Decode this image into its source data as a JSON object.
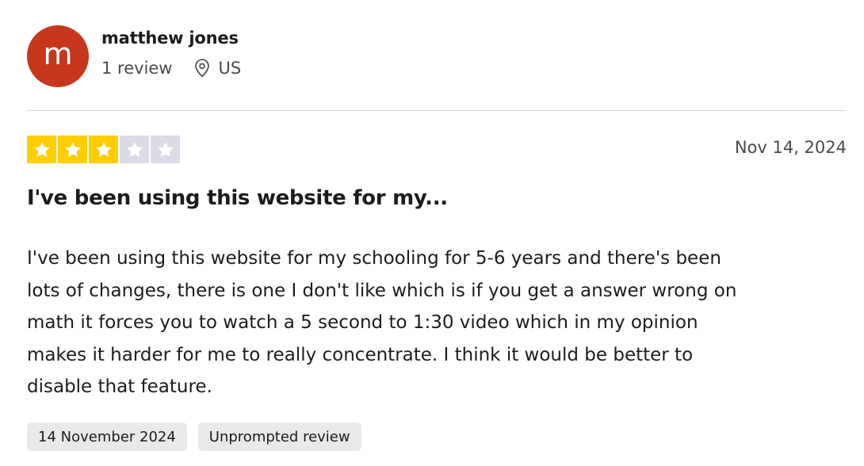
{
  "reviewer": {
    "avatar_letter": "m",
    "avatar_color": "#c7371e",
    "name": "matthew jones",
    "review_count": "1 review",
    "country": "US",
    "location_icon": "location-pin-icon"
  },
  "review": {
    "rating": 3,
    "max_rating": 5,
    "star_color": "#ffce00",
    "empty_star_color": "#dcdce6",
    "date": "Nov 14, 2024",
    "title": "I've been using this website for my...",
    "body_lines": [
      "I've been using this website for my schooling for 5-6 years and there's been",
      "lots of changes, there is one I don't like which is if you get a answer wrong on",
      "math it forces you to watch a 5 second to 1:30 video which in my opinion",
      "makes it harder for me to really concentrate. I think it would be better to",
      "disable that feature."
    ]
  },
  "tags": {
    "experience_date": "14 November 2024",
    "review_type": "Unprompted review"
  }
}
